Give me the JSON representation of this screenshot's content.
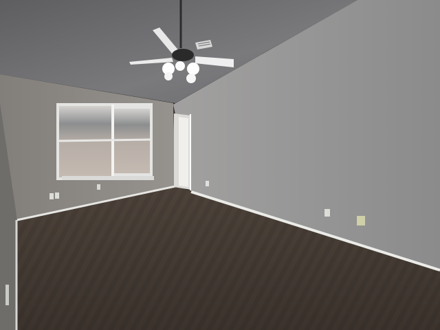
{
  "scene": {
    "subject": "empty-bedroom",
    "colors": {
      "ceiling": "#7d7d7f",
      "ceiling_dark": "#5d5d60",
      "back_wall": "#8e8b88",
      "right_wall": "#9a9898",
      "left_wall": "#7f7d7a",
      "carpet": "#4a4038",
      "carpet_dark": "#342d27",
      "baseboard": "#e9e9e6",
      "window_frame": "#e4e4e2",
      "window_light": "#b7b0aa",
      "trim": "#dcdcd8"
    },
    "icons": [
      "ceiling-fan-icon",
      "light-bulb-icon",
      "air-vent-icon",
      "wall-outlet-icon"
    ]
  }
}
